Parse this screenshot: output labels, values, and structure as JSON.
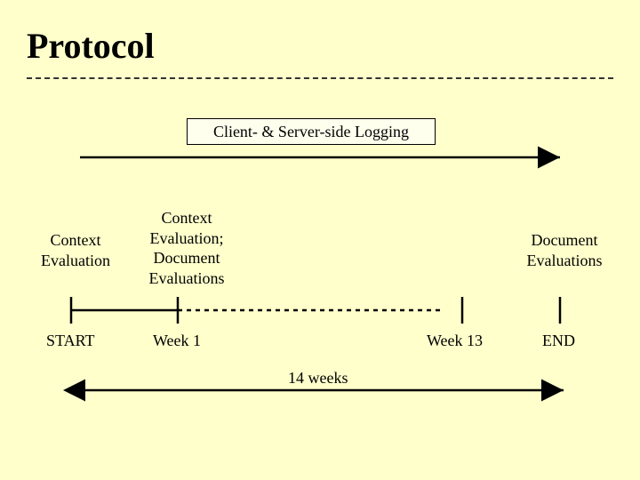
{
  "title": "Protocol",
  "logging_box": "Client- & Server-side Logging",
  "phases": {
    "start": "Context\nEvaluation",
    "week1": "Context\nEvaluation;\nDocument\nEvaluations",
    "end": "Document\nEvaluations"
  },
  "ticks": {
    "start": "START",
    "week1": "Week 1",
    "week13": "Week 13",
    "end": "END"
  },
  "duration": "14 weeks"
}
